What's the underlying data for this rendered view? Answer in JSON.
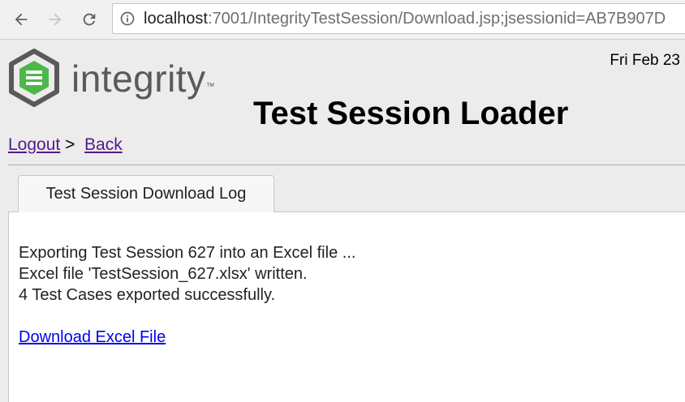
{
  "browser": {
    "url_host": "localhost",
    "url_path": ":7001/IntegrityTestSession/Download.jsp;jsessionid=AB7B907D"
  },
  "header": {
    "wordmark": "integrity",
    "trademark": "™",
    "date": "Fri Feb 23",
    "title": "Test Session Loader"
  },
  "breadcrumb": {
    "logout": "Logout",
    "separator": ">",
    "back": "Back"
  },
  "tab": {
    "label": "Test Session Download Log"
  },
  "log": {
    "lines": [
      "Exporting Test Session 627 into an Excel file ...",
      "Excel file 'TestSession_627.xlsx' written.",
      "4 Test Cases exported successfully."
    ],
    "download_link": "Download Excel File"
  },
  "colors": {
    "link_visited": "#551a8b",
    "link": "#0000ee",
    "logo_green": "#4cb848",
    "logo_gray": "#5a5a5a"
  }
}
